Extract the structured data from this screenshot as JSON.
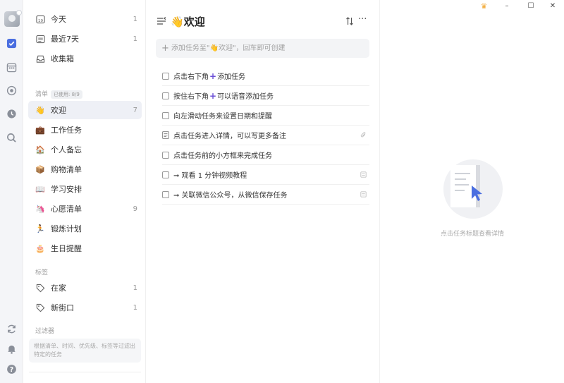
{
  "nav": {
    "today": {
      "label": "今天",
      "count": "1"
    },
    "next7": {
      "label": "最近7天",
      "count": "1"
    },
    "inbox": {
      "label": "收集箱"
    }
  },
  "lists_section": {
    "label": "清单",
    "usage": "已使用: 8/9"
  },
  "lists": [
    {
      "icon": "👋",
      "label": "欢迎",
      "count": "7"
    },
    {
      "icon": "💼",
      "label": "工作任务",
      "count": ""
    },
    {
      "icon": "🏠",
      "label": "个人备忘",
      "count": ""
    },
    {
      "icon": "📦",
      "label": "购物清单",
      "count": ""
    },
    {
      "icon": "📖",
      "label": "学习安排",
      "count": ""
    },
    {
      "icon": "🦄",
      "label": "心愿清单",
      "count": "9"
    },
    {
      "icon": "🏃",
      "label": "锻炼计划",
      "count": ""
    },
    {
      "icon": "🎂",
      "label": "生日提醒",
      "count": ""
    }
  ],
  "tags_section": {
    "label": "标签"
  },
  "tags": [
    {
      "label": "在家",
      "count": "1"
    },
    {
      "label": "新街口",
      "count": "1"
    }
  ],
  "filters_section": {
    "label": "过滤器",
    "hint": "根据清单、时间、优先级、标签等过滤出特定的任务"
  },
  "main": {
    "title_icon": "👋",
    "title": "欢迎",
    "more": "···",
    "add_placeholder": "添加任务至\"👋欢迎\"，回车即可创建"
  },
  "tasks": [
    {
      "pre": "点击右下角",
      "plus": "+",
      "post": "添加任务"
    },
    {
      "pre": "按住右下角",
      "plus": "+",
      "post": "可以语音添加任务"
    },
    {
      "pre": "向左滑动任务来设置日期和提醒",
      "plus": "",
      "post": ""
    },
    {
      "pre": "点击任务进入详情，可以写更多备注",
      "plus": "",
      "post": ""
    },
    {
      "pre": "点击任务前的小方框来完成任务",
      "plus": "",
      "post": ""
    },
    {
      "pre": "➞ 观看 1 分钟视频教程",
      "plus": "",
      "post": ""
    },
    {
      "pre": "➞ 关联微信公众号，从微信保存任务",
      "plus": "",
      "post": ""
    }
  ],
  "detail": {
    "empty_text": "点击任务标题查看详情"
  },
  "window": {
    "crown": "♛",
    "minimize": "–",
    "maximize": "☐",
    "close": "✕"
  },
  "colors": {
    "accent": "#4a6ee0",
    "purple_plus": "#6b4fd6",
    "crown": "#f0a020"
  }
}
